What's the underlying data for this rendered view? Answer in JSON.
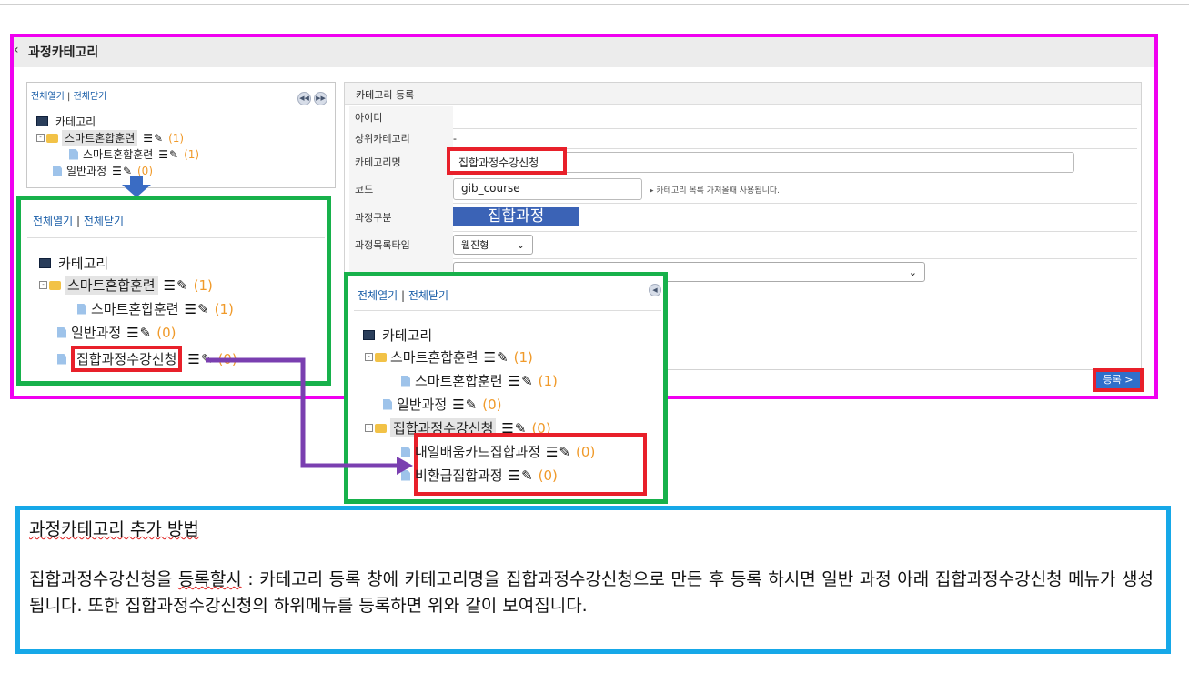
{
  "page": {
    "title": "과정카테고리",
    "back_icon": "chevron-left-icon"
  },
  "tree_controls": {
    "expand_all": "전체열기",
    "collapse_all": "전체닫기",
    "separator": "|"
  },
  "tree_top": {
    "root": "카테고리",
    "items": [
      {
        "label": "스마트혼합훈련",
        "count": "(1)"
      },
      {
        "label": "스마트혼합훈련",
        "count": "(1)"
      },
      {
        "label": "일반과정",
        "count": "(0)"
      }
    ]
  },
  "tree_mid": {
    "root": "카테고리",
    "items": [
      {
        "label": "스마트혼합훈련",
        "count": "(1)"
      },
      {
        "label": "스마트혼합훈련",
        "count": "(1)"
      },
      {
        "label": "일반과정",
        "count": "(0)"
      },
      {
        "label": "집합과정수강신청",
        "count": "(0)"
      }
    ]
  },
  "tree_overlay": {
    "root": "카테고리",
    "items": [
      {
        "label": "스마트혼합훈련",
        "count": "(1)"
      },
      {
        "label": "스마트혼합훈련",
        "count": "(1)"
      },
      {
        "label": "일반과정",
        "count": "(0)"
      },
      {
        "label": "집합과정수강신청",
        "count": "(0)"
      },
      {
        "label": "내일배움카드집합과정",
        "count": "(0)"
      },
      {
        "label": "비환급집합과정",
        "count": "(0)"
      }
    ]
  },
  "form": {
    "header": "카테고리 등록",
    "fields": {
      "id_label": "아이디",
      "parent_label": "상위카테고리",
      "parent_value": "-",
      "name_label": "카테고리명",
      "name_value": "집합과정수강신청",
      "code_label": "코드",
      "code_value": "gib_course",
      "code_hint": "카테고리 목록 가져올때 사용됩니다.",
      "type_label": "과정구분",
      "type_value": "집합과정",
      "listtype_label": "과정목록타입",
      "listtype_value": "웹진형"
    },
    "register_button": "등록 >"
  },
  "description": {
    "title": "과정카테고리 추가 방법",
    "lead": "집합과정수강신청을",
    "lead_mark": "등록할시",
    "body": " : 카테고리 등록 창에 카테고리명을 집합과정수강신청으로 만든 후 등록 하시면 일반 과정 아래 집합과정수강신청 메뉴가 생성됩니다. 또한 집합과정수강신청의 하위메뉴를 등록하면 위와 같이 보여집니다."
  },
  "colors": {
    "magenta": "#f000f0",
    "green": "#17b14b",
    "red": "#e8202a",
    "blue": "#16a8e8",
    "purple": "#7a3fb0",
    "count": "#f09a2a"
  }
}
